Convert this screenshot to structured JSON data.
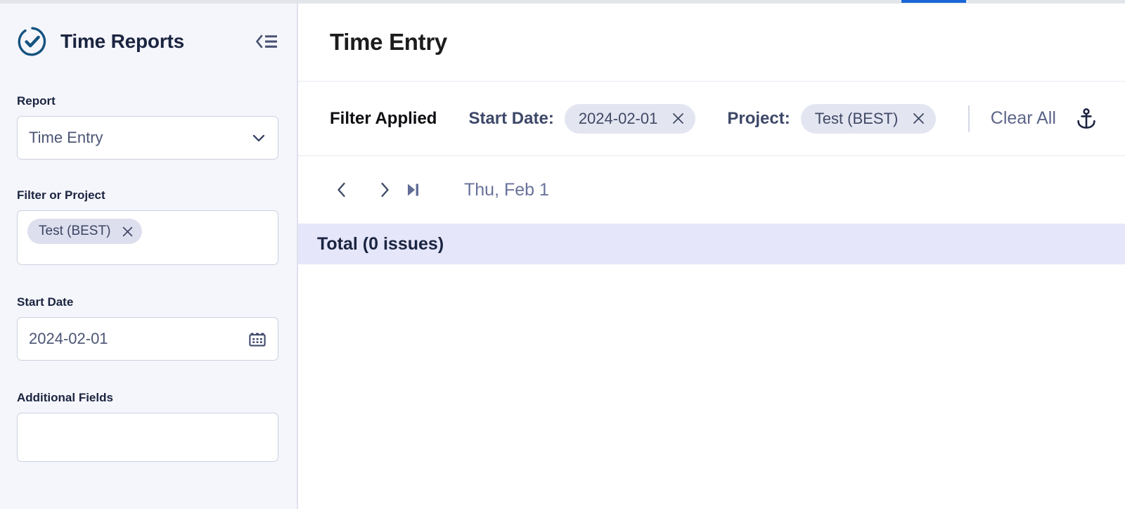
{
  "window": {
    "tab_indicator_color": "#1a66d6"
  },
  "sidebar": {
    "brand": {
      "logo_icon": "check-circle-icon",
      "title": "Time Reports"
    },
    "collapse_icon": "collapse-sidebar-icon",
    "fields": {
      "report": {
        "label": "Report",
        "value": "Time Entry",
        "chevron_icon": "chevron-down-icon"
      },
      "filter_or_project": {
        "label": "Filter or Project",
        "tokens": [
          {
            "label": "Test (BEST)",
            "remove_icon": "close-icon"
          }
        ]
      },
      "start_date": {
        "label": "Start Date",
        "value": "2024-02-01",
        "calendar_icon": "calendar-icon"
      },
      "additional_fields": {
        "label": "Additional Fields",
        "value": "",
        "placeholder": ""
      }
    }
  },
  "main": {
    "page_title": "Time Entry",
    "filter_bar": {
      "status_label": "Filter Applied",
      "filters": [
        {
          "key": "Start Date:",
          "value": "2024-02-01",
          "remove_icon": "close-icon"
        },
        {
          "key": "Project:",
          "value": "Test (BEST)",
          "remove_icon": "close-icon"
        }
      ],
      "clear_all_label": "Clear All",
      "anchor_icon": "anchor-icon"
    },
    "nav": {
      "prev_icon": "chevron-left-icon",
      "next_icon": "chevron-right-icon",
      "skip_end_icon": "skip-to-end-icon",
      "current_date": "Thu, Feb 1"
    },
    "total_row": {
      "label": "Total (0 issues)"
    }
  },
  "colors": {
    "sidebar_bg": "#f5f6fb",
    "brand_blue": "#15537f",
    "total_row_bg": "#e5e6fa",
    "pill_bg": "#e3e5f1",
    "accent_text": "#5c6589"
  }
}
